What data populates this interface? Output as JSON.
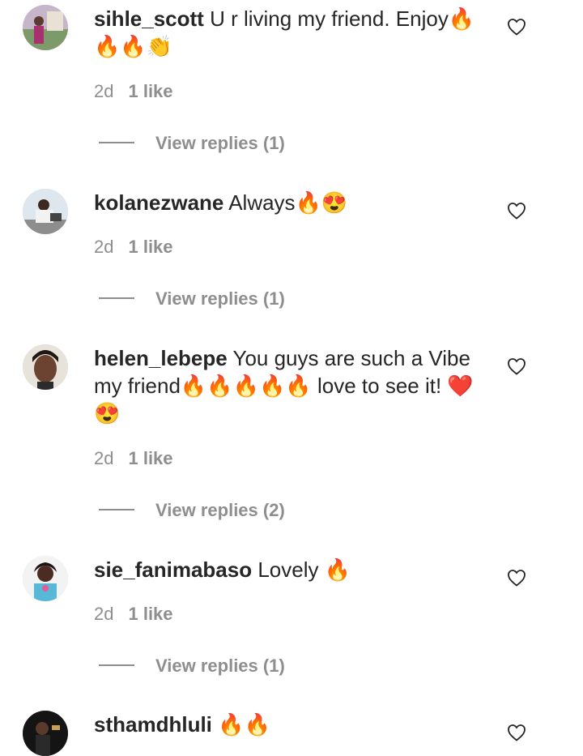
{
  "comments": [
    {
      "username": "sihle_scott",
      "text": "U r living my friend. Enjoy🔥🔥🔥👏",
      "time": "2d",
      "likes": "1 like",
      "replies": "View replies (1)"
    },
    {
      "username": "kolanezwane",
      "text": "Always🔥😍",
      "time": "2d",
      "likes": "1 like",
      "replies": "View replies (1)"
    },
    {
      "username": "helen_lebepe",
      "text": "You guys are such a Vibe my friend🔥🔥🔥🔥🔥 love to see it! ❤️😍",
      "time": "2d",
      "likes": "1 like",
      "replies": "View replies (2)"
    },
    {
      "username": "sie_fanimabaso",
      "text": "Lovely 🔥",
      "time": "2d",
      "likes": "1 like",
      "replies": "View replies (1)"
    },
    {
      "username": "sthamdhluli",
      "text": "🔥🔥"
    }
  ],
  "icons": {
    "like": "heart-outline-icon"
  }
}
